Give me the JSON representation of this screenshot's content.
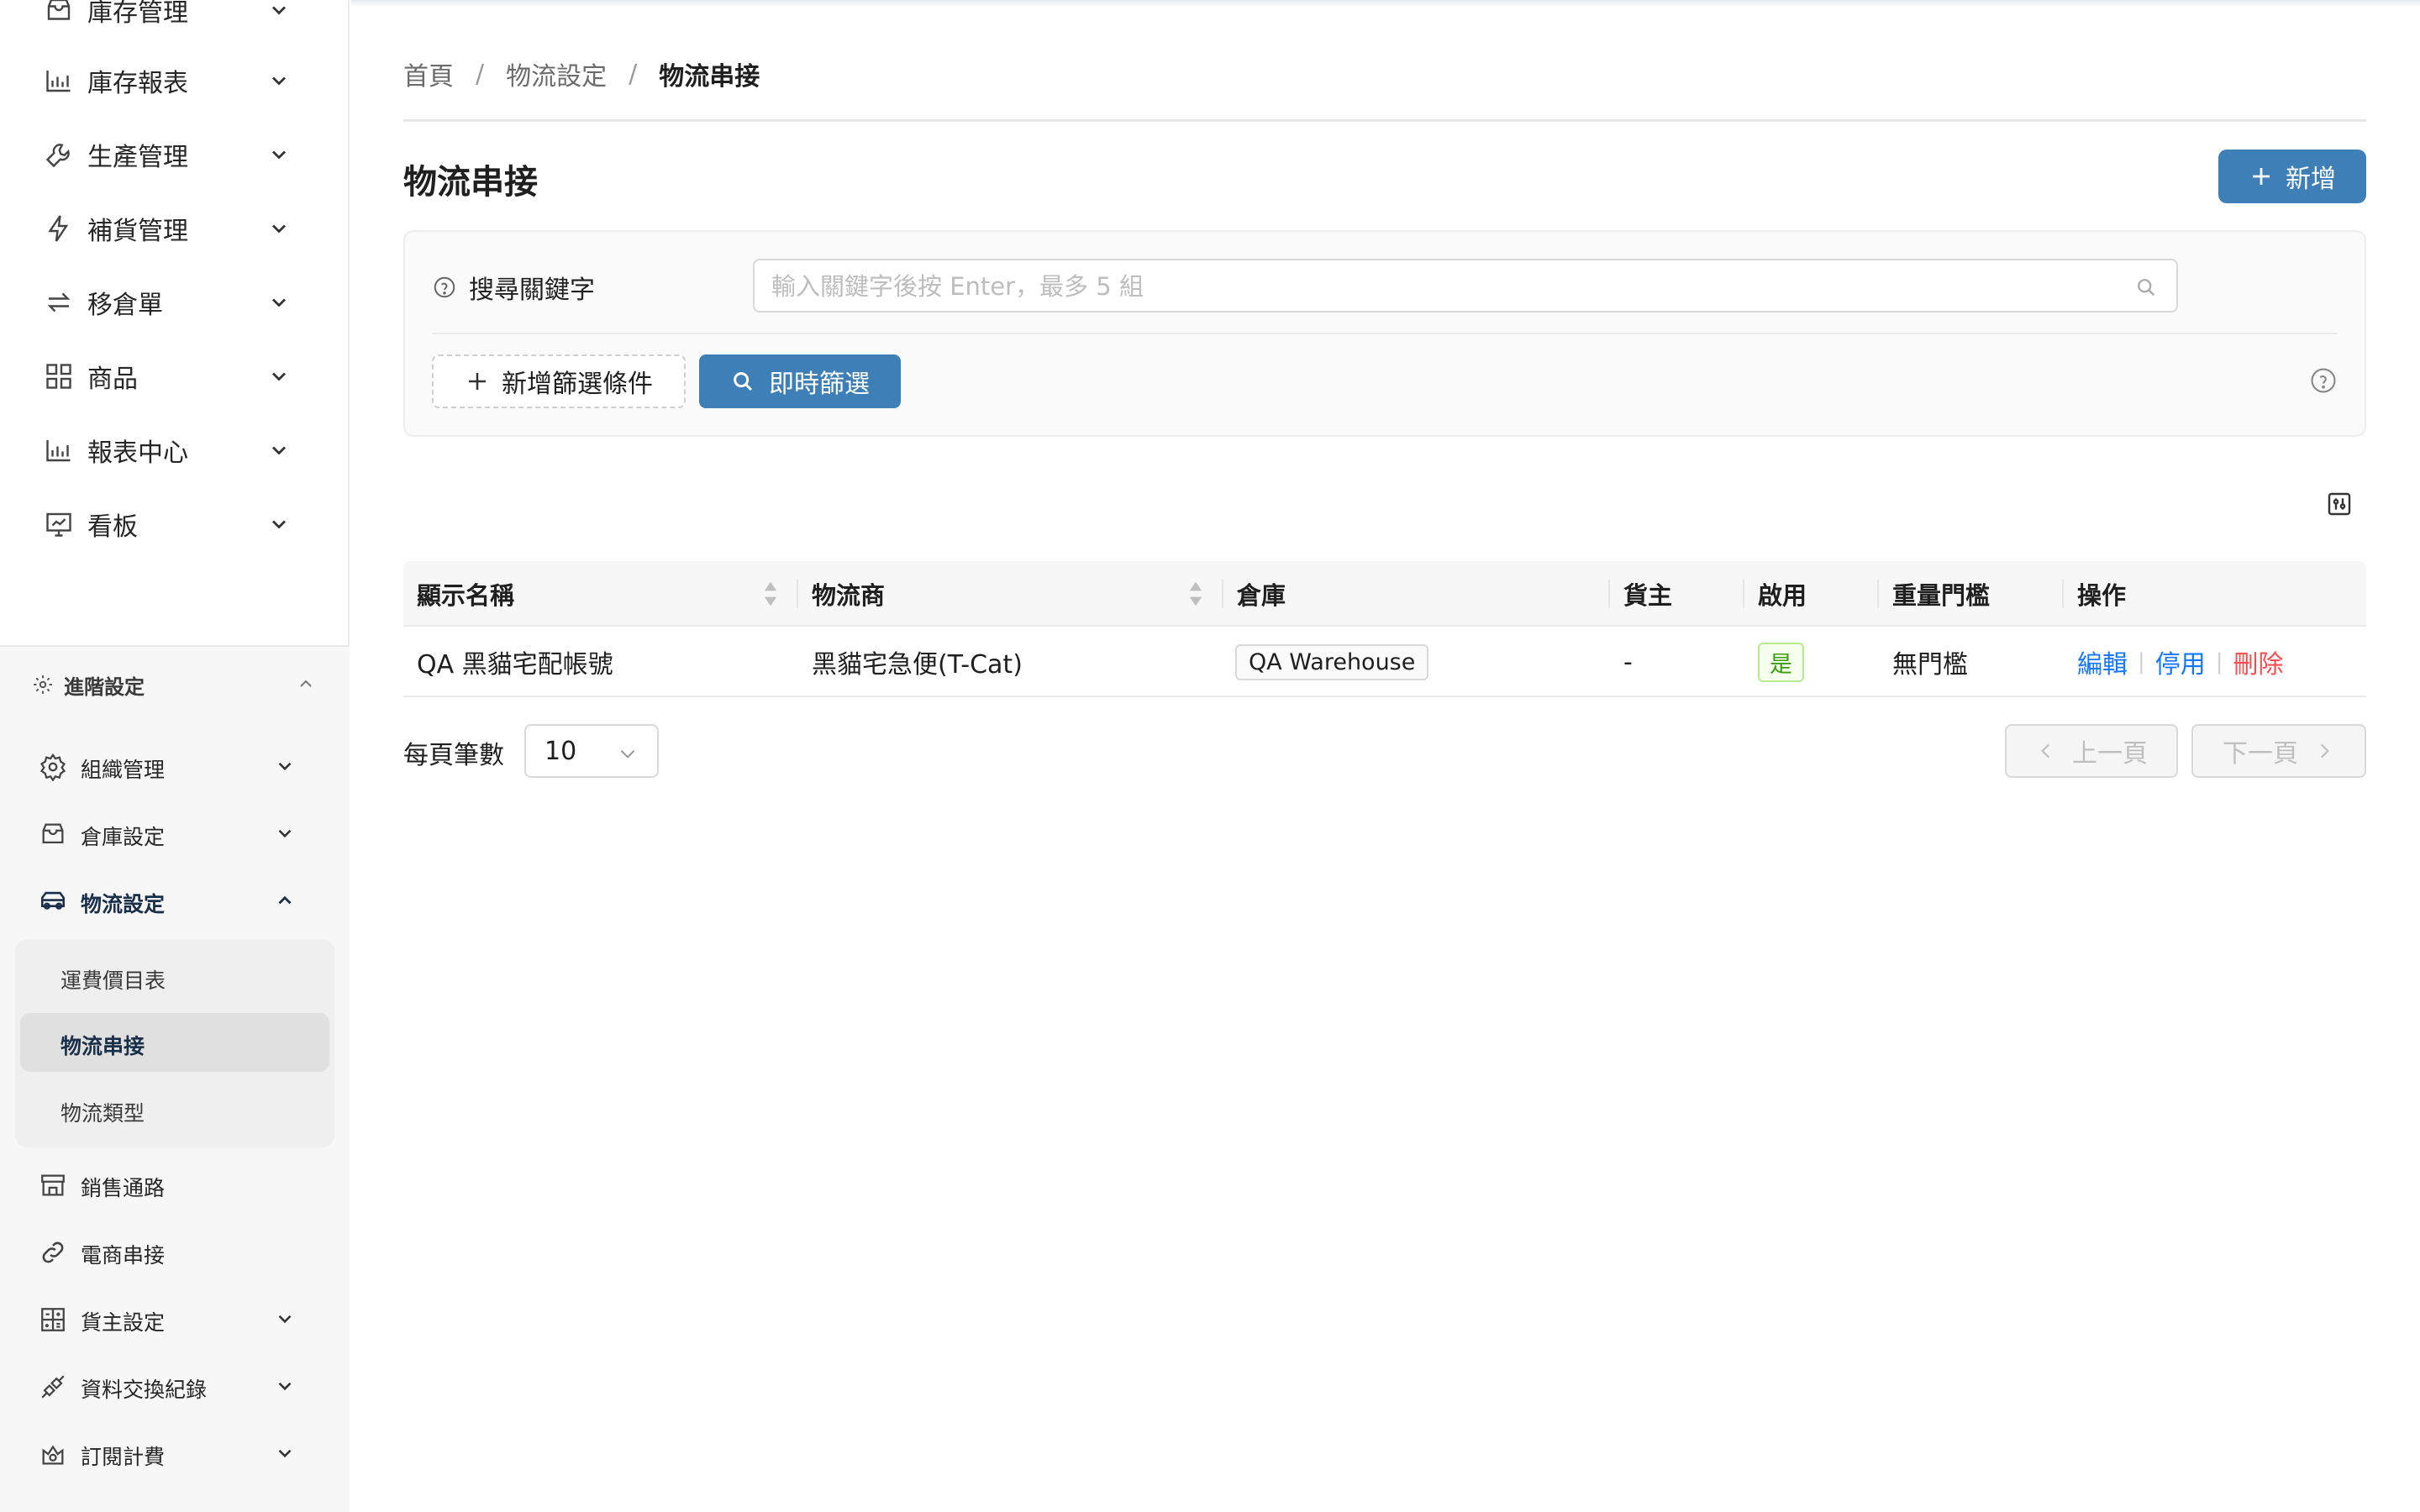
{
  "sidebar": {
    "top_items": [
      {
        "label": "庫存管理",
        "icon": "inventory-icon"
      },
      {
        "label": "庫存報表",
        "icon": "bar-chart-icon"
      },
      {
        "label": "生產管理",
        "icon": "wrench-icon"
      },
      {
        "label": "補貨管理",
        "icon": "lightning-icon"
      },
      {
        "label": "移倉單",
        "icon": "transfer-icon"
      },
      {
        "label": "商品",
        "icon": "grid-icon"
      },
      {
        "label": "報表中心",
        "icon": "bar-chart-icon"
      },
      {
        "label": "看板",
        "icon": "dashboard-icon"
      }
    ],
    "advanced": {
      "label": "進階設定",
      "items": [
        {
          "label": "組織管理",
          "icon": "gear-icon"
        },
        {
          "label": "倉庫設定",
          "icon": "inventory-icon"
        },
        {
          "label": "物流設定",
          "icon": "truck-icon"
        }
      ],
      "logistics_submenu": [
        {
          "label": "運費價目表"
        },
        {
          "label": "物流串接"
        },
        {
          "label": "物流類型"
        }
      ],
      "more_items": [
        {
          "label": "銷售通路",
          "icon": "store-icon"
        },
        {
          "label": "電商串接",
          "icon": "link-icon"
        },
        {
          "label": "貨主設定",
          "icon": "calculator-icon"
        },
        {
          "label": "資料交換紀錄",
          "icon": "api-icon"
        },
        {
          "label": "訂閱計費",
          "icon": "subscription-icon"
        }
      ]
    }
  },
  "breadcrumb": [
    "首頁",
    "物流設定",
    "物流串接"
  ],
  "page": {
    "title": "物流串接",
    "add_label": "新增"
  },
  "filter": {
    "search_label": "搜尋關鍵字",
    "search_placeholder": "輸入關鍵字後按 Enter，最多 5 組",
    "search_value": "",
    "add_filter_label": "新增篩選條件",
    "instant_filter_label": "即時篩選"
  },
  "table": {
    "columns": [
      "顯示名稱",
      "物流商",
      "倉庫",
      "貨主",
      "啟用",
      "重量門檻",
      "操作"
    ],
    "rows": [
      {
        "display_name": "QA 黑貓宅配帳號",
        "carrier": "黑貓宅急便(T-Cat)",
        "warehouse": "QA Warehouse",
        "owner": "-",
        "enabled": "是",
        "weight_threshold": "無門檻",
        "actions": {
          "edit": "編輯",
          "disable": "停用",
          "delete": "刪除"
        }
      }
    ]
  },
  "pagination": {
    "page_size_label": "每頁筆數",
    "page_size": "10",
    "prev_label": "上一頁",
    "next_label": "下一頁"
  },
  "colors": {
    "primary": "#3f7fb8",
    "link": "#1677ff",
    "danger": "#ff4d4f",
    "success": "#389e0d"
  }
}
